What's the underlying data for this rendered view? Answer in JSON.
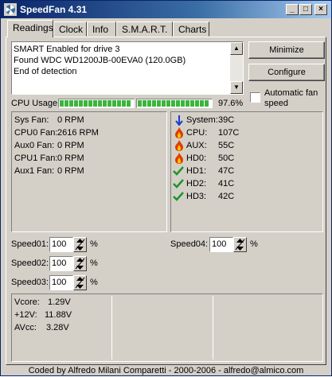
{
  "window": {
    "title": "SpeedFan 4.31"
  },
  "titlebar_buttons": {
    "minimize": "_",
    "maximize": "□",
    "close": "×"
  },
  "tabs": [
    {
      "label": "Readings"
    },
    {
      "label": "Clock"
    },
    {
      "label": "Info"
    },
    {
      "label": "S.M.A.R.T."
    },
    {
      "label": "Charts"
    }
  ],
  "log": {
    "lines": [
      "SMART Enabled for drive 3",
      "Found WDC WD1200JB-00EVA0 (120.0GB)",
      "End of detection"
    ]
  },
  "buttons": {
    "minimize": "Minimize",
    "configure": "Configure"
  },
  "auto_fan": {
    "label_line1": "Automatic fan",
    "label_line2": "speed",
    "checked": false
  },
  "cpu_usage": {
    "label": "CPU Usage",
    "percent_text": "97.6%",
    "cores": [
      0.976,
      0.976
    ]
  },
  "fans": [
    {
      "label": "Sys Fan:",
      "value": "0 RPM"
    },
    {
      "label": "CPU0 Fan:",
      "value": "2616 RPM"
    },
    {
      "label": "Aux0 Fan:",
      "value": "0 RPM"
    },
    {
      "label": "CPU1 Fan:",
      "value": "0 RPM"
    },
    {
      "label": "Aux1 Fan:",
      "value": "0 RPM"
    }
  ],
  "temps": [
    {
      "icon": "arrow-down-icon",
      "label": "System:",
      "value": "39C"
    },
    {
      "icon": "flame-icon",
      "label": "CPU:",
      "value": "107C"
    },
    {
      "icon": "flame-icon",
      "label": "AUX:",
      "value": "55C"
    },
    {
      "icon": "flame-icon",
      "label": "HD0:",
      "value": "50C"
    },
    {
      "icon": "checkmark-icon",
      "label": "HD1:",
      "value": "47C"
    },
    {
      "icon": "checkmark-icon",
      "label": "HD2:",
      "value": "41C"
    },
    {
      "icon": "checkmark-icon",
      "label": "HD3:",
      "value": "42C"
    }
  ],
  "speeds": [
    {
      "label": "Speed01:",
      "value": "100",
      "unit": "%"
    },
    {
      "label": "Speed02:",
      "value": "100",
      "unit": "%"
    },
    {
      "label": "Speed03:",
      "value": "100",
      "unit": "%"
    },
    {
      "label": "Speed04:",
      "value": "100",
      "unit": "%"
    }
  ],
  "voltages": [
    {
      "label": "Vcore:",
      "value": "1.29V"
    },
    {
      "label": "+12V:",
      "value": "11.88V"
    },
    {
      "label": "AVcc:",
      "value": "3.28V"
    }
  ],
  "status": {
    "credits": "Coded by Alfredo Milani Comparetti - 2000-2006 - alfredo@almico.com"
  },
  "colors": {
    "titlebar": "#0a246a",
    "usage_fill": "#3cb43c",
    "down_arrow": "#1a3cc8",
    "flame": "#e03c00",
    "check": "#1e9628"
  }
}
